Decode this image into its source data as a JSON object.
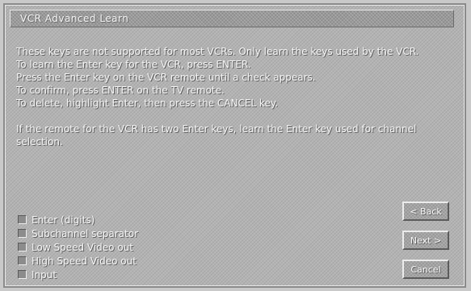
{
  "window": {
    "title": "VCR Advanced Learn"
  },
  "instructions": {
    "line1": "These keys are not supported for most VCRs. Only learn the keys used by the VCR.",
    "line2": "To learn the Enter key for the VCR, press ENTER.",
    "line3": "Press the Enter key on the VCR remote until a check appears.",
    "line4": "To confirm, press ENTER on the TV remote.",
    "line5": "To delete, highlight Enter, then press the CANCEL key.",
    "note": "If the remote for the VCR has two Enter keys, learn the Enter key used for channel selection."
  },
  "keys": [
    {
      "label": "Enter (digits)"
    },
    {
      "label": "Subchannel separator"
    },
    {
      "label": "Low Speed Video out"
    },
    {
      "label": "High Speed Video out"
    },
    {
      "label": "Input"
    }
  ],
  "buttons": {
    "back": "< Back",
    "next": "Next >",
    "cancel": "Cancel"
  }
}
